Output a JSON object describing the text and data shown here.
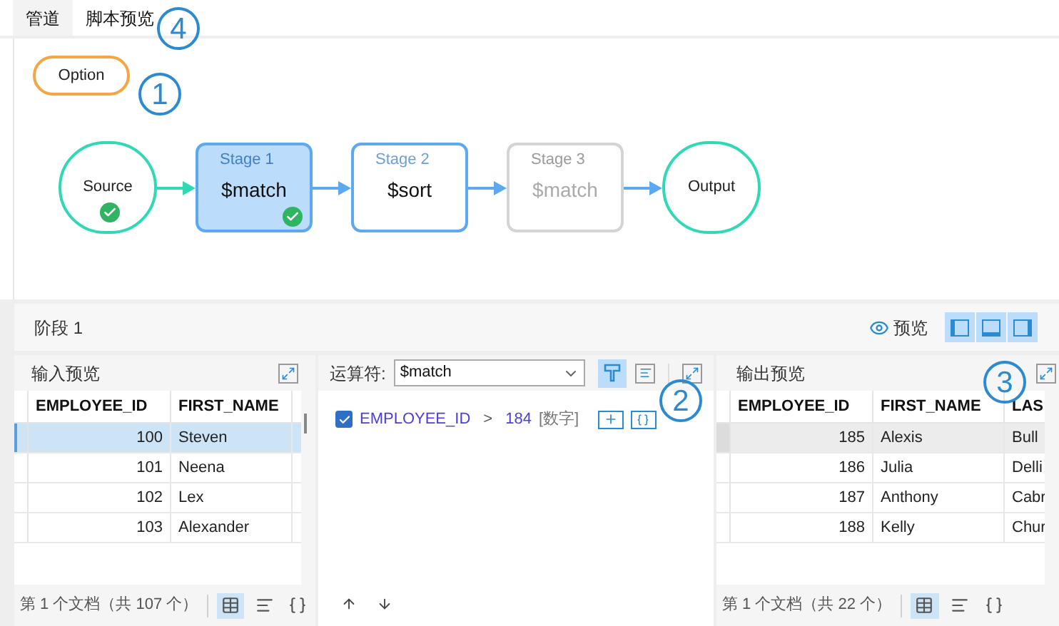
{
  "tabs": [
    {
      "label": "管道",
      "selected": true
    },
    {
      "label": "脚本预览",
      "selected": false
    }
  ],
  "callouts": [
    "4",
    "1",
    "2",
    "3"
  ],
  "option_button": "Option",
  "pipeline": [
    {
      "kind": "terminal",
      "label": "Source",
      "ok": true
    },
    {
      "kind": "stage",
      "stage": "Stage 1",
      "op": "$match",
      "selected": true,
      "disabled": false,
      "ok": true
    },
    {
      "kind": "stage",
      "stage": "Stage 2",
      "op": "$sort",
      "selected": false,
      "disabled": false,
      "ok": false
    },
    {
      "kind": "stage",
      "stage": "Stage 3",
      "op": "$match",
      "selected": false,
      "disabled": true,
      "ok": false
    },
    {
      "kind": "terminal",
      "label": "Output",
      "ok": false
    }
  ],
  "stage_title": "阶段 1",
  "preview_toggle": "预览",
  "input_preview": {
    "title": "输入预览",
    "columns": [
      "EMPLOYEE_ID",
      "FIRST_NAME"
    ],
    "rows": [
      {
        "cells": [
          "100",
          "Steven"
        ],
        "selected": true
      },
      {
        "cells": [
          "101",
          "Neena"
        ],
        "selected": false
      },
      {
        "cells": [
          "102",
          "Lex"
        ],
        "selected": false
      },
      {
        "cells": [
          "103",
          "Alexander"
        ],
        "selected": false
      }
    ],
    "footer": "第 1 个文档（共 107 个）"
  },
  "operator": {
    "label": "运算符:",
    "value": "$match",
    "conditions": [
      {
        "checked": true,
        "field": "EMPLOYEE_ID",
        "op": ">",
        "value": "184",
        "type": "[数字]"
      }
    ]
  },
  "output_preview": {
    "title": "输出预览",
    "columns": [
      "EMPLOYEE_ID",
      "FIRST_NAME",
      "LAS"
    ],
    "rows": [
      {
        "cells": [
          "185",
          "Alexis",
          "Bull"
        ],
        "selected": true
      },
      {
        "cells": [
          "186",
          "Julia",
          "Delli"
        ],
        "selected": false
      },
      {
        "cells": [
          "187",
          "Anthony",
          "Cabr"
        ],
        "selected": false
      },
      {
        "cells": [
          "188",
          "Kelly",
          "Chur"
        ],
        "selected": false
      }
    ],
    "footer": "第 1 个文档（共 22 个）"
  }
}
